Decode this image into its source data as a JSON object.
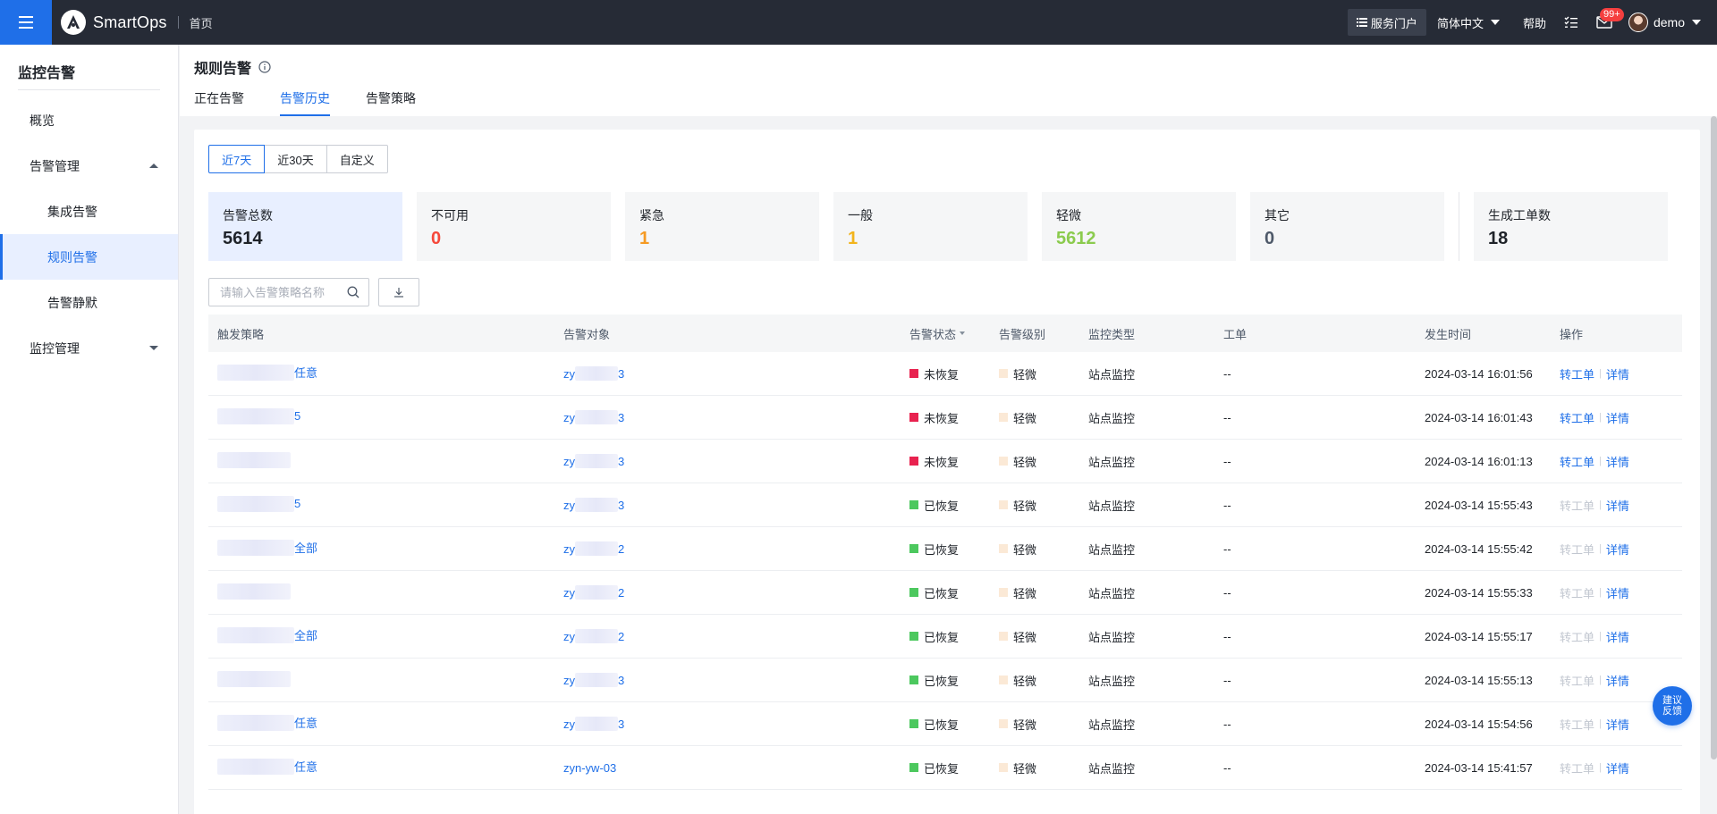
{
  "topbar": {
    "logo_text": "SmartOps",
    "breadcrumb": "首页",
    "portal_label": "服务门户",
    "language": "简体中文",
    "help": "帮助",
    "badge": "99+",
    "user": "demo"
  },
  "sidebar": {
    "title": "监控告警",
    "items": [
      {
        "label": "概览"
      },
      {
        "label": "告警管理"
      },
      {
        "label": "集成告警"
      },
      {
        "label": "规则告警"
      },
      {
        "label": "告警静默"
      },
      {
        "label": "监控管理"
      }
    ]
  },
  "page": {
    "title": "规则告警",
    "tabs": [
      {
        "label": "正在告警"
      },
      {
        "label": "告警历史"
      },
      {
        "label": "告警策略"
      }
    ]
  },
  "ranges": [
    "近7天",
    "近30天",
    "自定义"
  ],
  "stats": [
    {
      "label": "告警总数",
      "value": "5614",
      "color": "#1f2329"
    },
    {
      "label": "不可用",
      "value": "0",
      "color": "#f5483b"
    },
    {
      "label": "紧急",
      "value": "1",
      "color": "#f59a23"
    },
    {
      "label": "一般",
      "value": "1",
      "color": "#f2b41c"
    },
    {
      "label": "轻微",
      "value": "5612",
      "color": "#8bcb4e"
    },
    {
      "label": "其它",
      "value": "0",
      "color": "#4e5969"
    },
    {
      "label": "生成工单数",
      "value": "18",
      "color": "#1f2329"
    }
  ],
  "search": {
    "placeholder": "请输入告警策略名称"
  },
  "table": {
    "headers": {
      "policy": "触发策略",
      "target": "告警对象",
      "status": "告警状态",
      "level": "告警级别",
      "type": "监控类型",
      "ticket": "工单",
      "time": "发生时间",
      "ops": "操作"
    },
    "rows": [
      {
        "policy": "任意",
        "target_prefix": "zy",
        "target_suffix": "3",
        "status": "未恢复",
        "status_color": "#e8224f",
        "level": "轻微",
        "type": "站点监控",
        "ticket": "--",
        "time": "2024-03-14 16:01:56",
        "op1": "转工单",
        "op2": "详情"
      },
      {
        "policy": "5",
        "target_prefix": "zy",
        "target_suffix": "3",
        "status": "未恢复",
        "status_color": "#e8224f",
        "level": "轻微",
        "type": "站点监控",
        "ticket": "--",
        "time": "2024-03-14 16:01:43",
        "op1": "转工单",
        "op2": "详情"
      },
      {
        "policy": "",
        "target_prefix": "zy",
        "target_suffix": "3",
        "status": "未恢复",
        "status_color": "#e8224f",
        "level": "轻微",
        "type": "站点监控",
        "ticket": "--",
        "time": "2024-03-14 16:01:13",
        "op1": "转工单",
        "op2": "详情"
      },
      {
        "policy": "5",
        "target_prefix": "zy",
        "target_suffix": "3",
        "status": "已恢复",
        "status_color": "#4cc85e",
        "level": "轻微",
        "type": "站点监控",
        "ticket": "--",
        "time": "2024-03-14 15:55:43",
        "op1": "转工单",
        "op2": "详情"
      },
      {
        "policy": "全部",
        "target_prefix": "zy",
        "target_suffix": "2",
        "status": "已恢复",
        "status_color": "#4cc85e",
        "level": "轻微",
        "type": "站点监控",
        "ticket": "--",
        "time": "2024-03-14 15:55:42",
        "op1": "转工单",
        "op2": "详情"
      },
      {
        "policy": "",
        "target_prefix": "zy",
        "target_suffix": "2",
        "status": "已恢复",
        "status_color": "#4cc85e",
        "level": "轻微",
        "type": "站点监控",
        "ticket": "--",
        "time": "2024-03-14 15:55:33",
        "op1": "转工单",
        "op2": "详情"
      },
      {
        "policy": "全部",
        "target_prefix": "zy",
        "target_suffix": "2",
        "status": "已恢复",
        "status_color": "#4cc85e",
        "level": "轻微",
        "type": "站点监控",
        "ticket": "--",
        "time": "2024-03-14 15:55:17",
        "op1": "转工单",
        "op2": "详情"
      },
      {
        "policy": "",
        "target_prefix": "zy",
        "target_suffix": "3",
        "status": "已恢复",
        "status_color": "#4cc85e",
        "level": "轻微",
        "type": "站点监控",
        "ticket": "--",
        "time": "2024-03-14 15:55:13",
        "op1": "转工单",
        "op2": "详情"
      },
      {
        "policy": "任意",
        "target_prefix": "zy",
        "target_suffix": "3",
        "status": "已恢复",
        "status_color": "#4cc85e",
        "level": "轻微",
        "type": "站点监控",
        "ticket": "--",
        "time": "2024-03-14 15:54:56",
        "op1": "转工单",
        "op2": "详情"
      },
      {
        "policy": "任意",
        "target_prefix": "zyn-yw-03",
        "target_suffix": "",
        "status": "已恢复",
        "status_color": "#4cc85e",
        "level": "轻微",
        "type": "站点监控",
        "ticket": "--",
        "time": "2024-03-14 15:41:57",
        "op1": "转工单",
        "op2": "详情"
      }
    ]
  },
  "feedback": "建议反馈",
  "colors": {
    "accent": "#1f6fe8",
    "topbar": "#262b36"
  }
}
